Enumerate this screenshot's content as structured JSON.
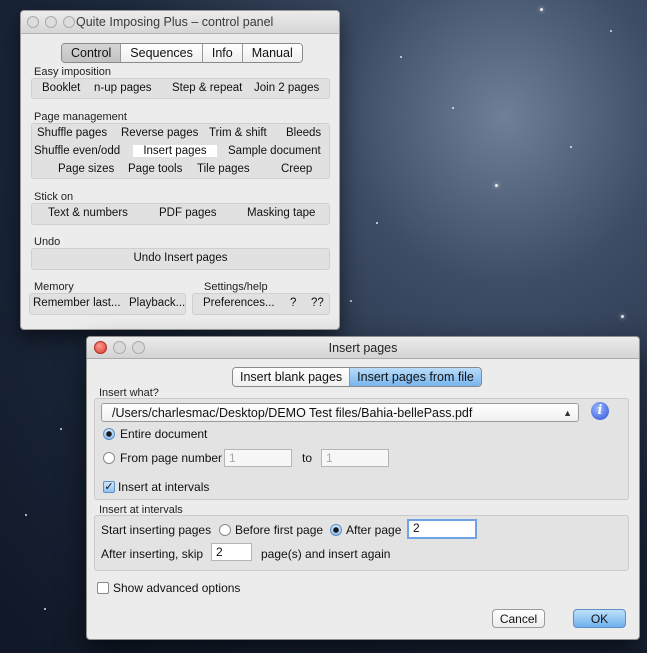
{
  "control_panel": {
    "title": "Quite Imposing Plus – control panel",
    "tabs": [
      "Control",
      "Sequences",
      "Info",
      "Manual"
    ],
    "easy_imposition": {
      "label": "Easy imposition",
      "buttons": [
        "Booklet",
        "n-up pages",
        "Step & repeat",
        "Join 2 pages"
      ]
    },
    "page_management": {
      "label": "Page management",
      "row1": [
        "Shuffle pages",
        "Reverse pages",
        "Trim & shift",
        "Bleeds"
      ],
      "row2": [
        "Shuffle even/odd",
        "Insert pages",
        "Sample document"
      ],
      "row3": [
        "Page sizes",
        "Page tools",
        "Tile pages",
        "Creep"
      ]
    },
    "stick_on": {
      "label": "Stick on",
      "buttons": [
        "Text & numbers",
        "PDF pages",
        "Masking tape"
      ]
    },
    "undo": {
      "label": "Undo",
      "button": "Undo Insert pages"
    },
    "memory": {
      "label": "Memory",
      "buttons": [
        "Remember last...",
        "Playback..."
      ]
    },
    "settings": {
      "label": "Settings/help",
      "buttons": [
        "Preferences...",
        "?",
        "??"
      ]
    }
  },
  "dialog": {
    "title": "Insert pages",
    "mode_tabs": [
      "Insert blank pages",
      "Insert pages from file"
    ],
    "insert_what": {
      "label": "Insert what?",
      "file_path": "/Users/charlesmac/Desktop/DEMO Test files/Bahia-bellePass.pdf",
      "entire_document": "Entire document",
      "from_page_number": "From page number",
      "from_value": "1",
      "to_label": "to",
      "to_value": "1",
      "insert_at_intervals": "Insert at intervals"
    },
    "intervals": {
      "label": "Insert at intervals",
      "start_label": "Start inserting pages",
      "before_first": "Before first page",
      "after_page": "After page",
      "after_page_value": "2",
      "skip_label": "After inserting, skip",
      "skip_value": "2",
      "skip_suffix": "page(s) and insert again"
    },
    "advanced": "Show advanced options",
    "cancel": "Cancel",
    "ok": "OK"
  }
}
